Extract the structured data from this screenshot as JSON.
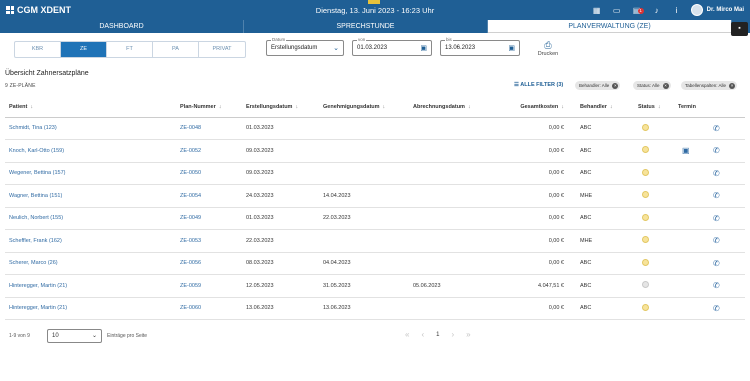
{
  "app": {
    "title": "CGM XDENT",
    "datetime": "Dienstag, 13. Juni 2023 - 16:23 Uhr",
    "user": "Dr. Mirco Mai",
    "notification_count": "1"
  },
  "nav_tabs": [
    {
      "label": "DASHBOARD"
    },
    {
      "label": "SPRECHSTUNDE"
    },
    {
      "label": "PLANVERWALTUNG (ZE)"
    }
  ],
  "segments": [
    "KBR",
    "ZE",
    "FT",
    "PA",
    "PRIVAT"
  ],
  "filters": {
    "date_type": {
      "label": "Datum",
      "value": "Erstellungsdatum"
    },
    "from": {
      "label": "von",
      "value": "01.03.2023"
    },
    "to": {
      "label": "bis",
      "value": "13.06.2023"
    },
    "print_label": "Drucken"
  },
  "overview": {
    "title": "Übersicht Zahnersatzpläne",
    "count_label": "9 ZE-PLÄNE",
    "all_filters": "ALLE FILTER (3)",
    "chips": [
      "Behandler: Alle",
      "Status: Alle",
      "Tabellenspalten: Alle"
    ]
  },
  "table": {
    "headers": [
      "Patient",
      "Plan-Nummer",
      "Erstellungsdatum",
      "Genehmigungsdatum",
      "Abrechnungsdatum",
      "Gesamtkosten",
      "Behandler",
      "Status",
      "Termin"
    ],
    "rows": [
      {
        "patient": "Schmidt, Tina (123)",
        "plan": "ZE-0048",
        "created": "01.03.2023",
        "approved": "",
        "billed": "",
        "cost": "0,00 €",
        "dentist": "ABC",
        "status": "yellow",
        "termin": false
      },
      {
        "patient": "Knoch, Karl-Otto (159)",
        "plan": "ZE-0052",
        "created": "09.03.2023",
        "approved": "",
        "billed": "",
        "cost": "0,00 €",
        "dentist": "ABC",
        "status": "yellow",
        "termin": true
      },
      {
        "patient": "Wegener, Bettina (157)",
        "plan": "ZE-0050",
        "created": "09.03.2023",
        "approved": "",
        "billed": "",
        "cost": "0,00 €",
        "dentist": "ABC",
        "status": "yellow",
        "termin": false
      },
      {
        "patient": "Wagner, Bettina (151)",
        "plan": "ZE-0054",
        "created": "24.03.2023",
        "approved": "14.04.2023",
        "billed": "",
        "cost": "0,00 €",
        "dentist": "MHE",
        "status": "yellow",
        "termin": false
      },
      {
        "patient": "Neulich, Norbert (155)",
        "plan": "ZE-0049",
        "created": "01.03.2023",
        "approved": "22.03.2023",
        "billed": "",
        "cost": "0,00 €",
        "dentist": "ABC",
        "status": "yellow",
        "termin": false
      },
      {
        "patient": "Scheffler, Frank (162)",
        "plan": "ZE-0053",
        "created": "22.03.2023",
        "approved": "",
        "billed": "",
        "cost": "0,00 €",
        "dentist": "MHE",
        "status": "yellow",
        "termin": false
      },
      {
        "patient": "Scherer, Marco (26)",
        "plan": "ZE-0056",
        "created": "08.03.2023",
        "approved": "04.04.2023",
        "billed": "",
        "cost": "0,00 €",
        "dentist": "ABC",
        "status": "yellow",
        "termin": false
      },
      {
        "patient": "Hinteregger, Martin (21)",
        "plan": "ZE-0059",
        "created": "12.05.2023",
        "approved": "31.05.2023",
        "billed": "05.06.2023",
        "cost": "4.047,51 €",
        "dentist": "ABC",
        "status": "grey",
        "termin": false
      },
      {
        "patient": "Hinteregger, Martin (21)",
        "plan": "ZE-0060",
        "created": "13.06.2023",
        "approved": "13.06.2023",
        "billed": "",
        "cost": "0,00 €",
        "dentist": "ABC",
        "status": "yellow",
        "termin": false
      }
    ]
  },
  "pagination": {
    "range": "1-9 von 9",
    "per_page": "10",
    "per_page_label": "Einträge pro Seite",
    "page": "1"
  }
}
